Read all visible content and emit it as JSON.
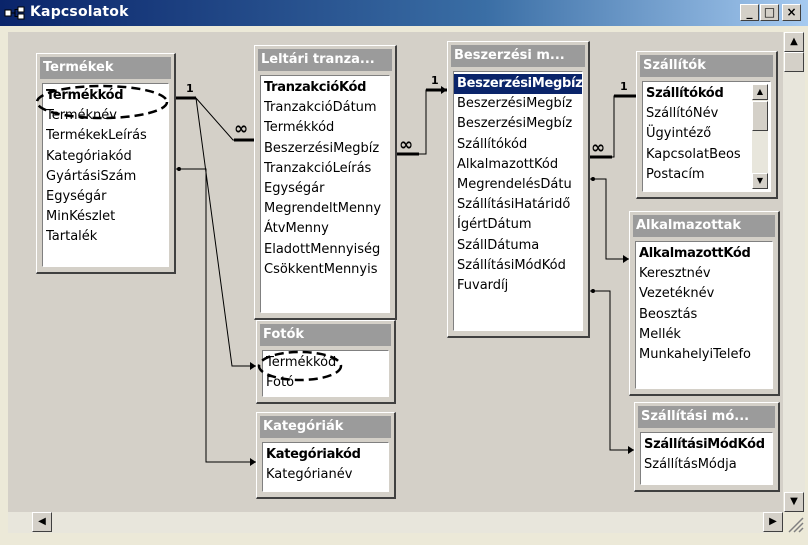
{
  "window": {
    "title": "Kapcsolatok",
    "min_label": "_",
    "max_label": "□",
    "close_label": "×"
  },
  "colors": {
    "titlebar": "#0a246a",
    "table_header": "#9b9b9b",
    "canvas": "#d4d0c8",
    "selection": "#0a246a"
  },
  "tables": {
    "termekek": {
      "title": "Termékek",
      "fields": [
        "Termékkód",
        "Terméknév",
        "TermékekLeírás",
        "Kategóriakód",
        "GyártásiSzám",
        "Egységár",
        "MinKészlet",
        "Tartalék"
      ]
    },
    "leltari": {
      "title": "Leltári tranza...",
      "fields": [
        "TranzakcióKód",
        "TranzakcióDátum",
        "Termékkód",
        "BeszerzésiMegbíz",
        "TranzakcióLeírás",
        "Egységár",
        "MegrendeltMenny",
        "ÁtvMenny",
        "EladottMennyiség",
        "CsökkentMennyis"
      ]
    },
    "beszerzesi": {
      "title": "Beszerzési m...",
      "fields": [
        "BeszerzésiMegbíz",
        "BeszerzésiMegbíz",
        "BeszerzésiMegbíz",
        "Szállítókód",
        "AlkalmazottKód",
        "MegrendelésDátu",
        "SzállításiHatáridő",
        "ÍgértDátum",
        "SzállDátuma",
        "SzállításiMódKód",
        "Fuvardíj"
      ]
    },
    "szallitok": {
      "title": "Szállítók",
      "fields": [
        "Szállítókód",
        "SzállítóNév",
        "Ügyintéző",
        "KapcsolatBeos",
        "Postacím"
      ]
    },
    "alkalmazottak": {
      "title": "Alkalmazottak",
      "fields": [
        "AlkalmazottKód",
        "Keresztnév",
        "Vezetéknév",
        "Beosztás",
        "Mellék",
        "MunkahelyiTelefo"
      ]
    },
    "fotok": {
      "title": "Fotók",
      "fields": [
        "Termékkód",
        "Fotó"
      ]
    },
    "kategoriak": {
      "title": "Kategóriák",
      "fields": [
        "Kategóriakód",
        "Kategórianév"
      ]
    },
    "szallitasi_modok": {
      "title": "Szállítási mó...",
      "fields": [
        "SzállításiMódKód",
        "SzállításMódja"
      ]
    }
  },
  "relationship_labels": {
    "one": "1",
    "many": "∞"
  }
}
